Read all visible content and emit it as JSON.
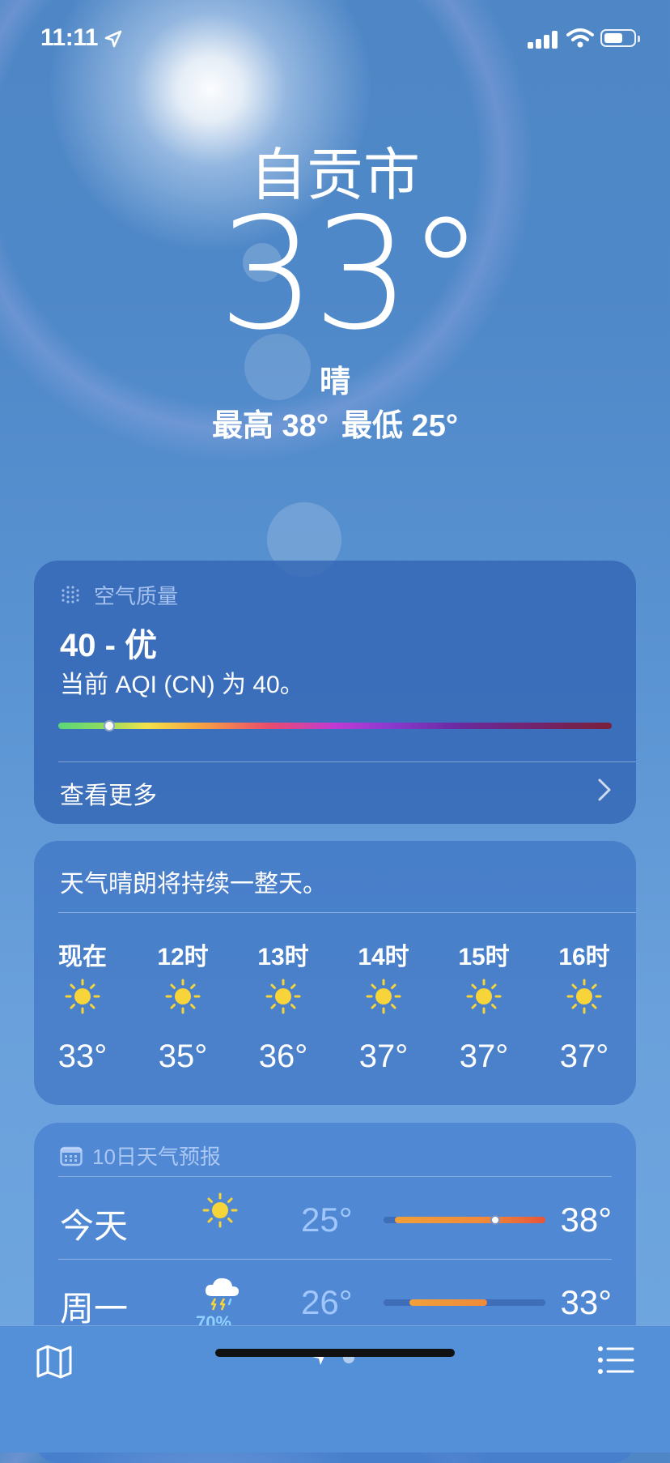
{
  "status_bar": {
    "time": "11:11"
  },
  "hero": {
    "city": "自贡市",
    "temperature": "33°",
    "condition": "晴",
    "high": "最高 38°",
    "low": "最低 25°"
  },
  "air_quality": {
    "header": "空气质量",
    "value": "40 - 优",
    "description": "当前 AQI (CN) 为 40。",
    "level_fraction": 0.09,
    "more_label": "查看更多"
  },
  "hourly": {
    "summary": "天气晴朗将持续一整天。",
    "items": [
      {
        "label": "现在",
        "icon": "sun-icon",
        "temp": "33°"
      },
      {
        "label": "12时",
        "icon": "sun-icon",
        "temp": "35°"
      },
      {
        "label": "13时",
        "icon": "sun-icon",
        "temp": "36°"
      },
      {
        "label": "14时",
        "icon": "sun-icon",
        "temp": "37°"
      },
      {
        "label": "15时",
        "icon": "sun-icon",
        "temp": "37°"
      },
      {
        "label": "16时",
        "icon": "sun-icon",
        "temp": "37°"
      }
    ]
  },
  "daily": {
    "header": "10日天气预报",
    "days": [
      {
        "name": "今天",
        "icon": "sun-icon",
        "precip": "",
        "low": "25°",
        "high": "38°"
      },
      {
        "name": "周一",
        "icon": "thunderstorm-icon",
        "precip": "70%",
        "low": "26°",
        "high": "33°"
      }
    ]
  },
  "colors": {
    "sun": "#f7d43a",
    "range_orange": "#f0953a",
    "range_red": "#e8553a"
  }
}
